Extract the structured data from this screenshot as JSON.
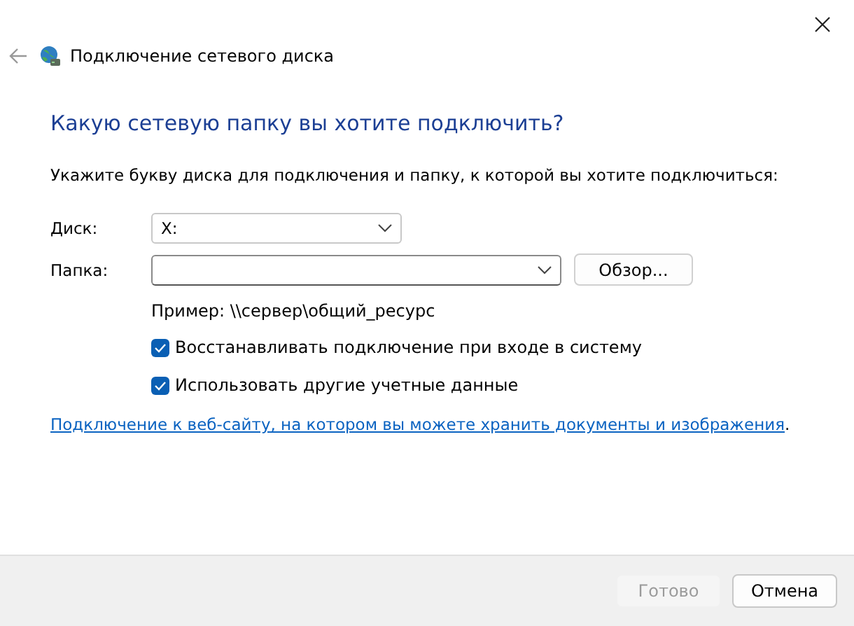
{
  "window": {
    "title": "Подключение сетевого диска"
  },
  "heading": "Какую сетевую папку вы хотите подключить?",
  "instruction": "Укажите букву диска для подключения и папку, к которой вы хотите подключиться:",
  "drive": {
    "label": "Диск:",
    "value": "X:"
  },
  "folder": {
    "label": "Папка:",
    "browse_button": "Обзор..."
  },
  "example": "Пример: \\\\сервер\\общий_ресурс",
  "options": [
    {
      "label": "Восстанавливать подключение при входе в систему",
      "checked": true
    },
    {
      "label": "Использовать другие учетные данные",
      "checked": true
    }
  ],
  "link": {
    "text": "Подключение к веб-сайту, на котором вы можете хранить документы и изображения",
    "suffix": "."
  },
  "buttons": [
    {
      "label": "Готово",
      "disabled": true
    },
    {
      "label": "Отмена",
      "disabled": false
    }
  ]
}
